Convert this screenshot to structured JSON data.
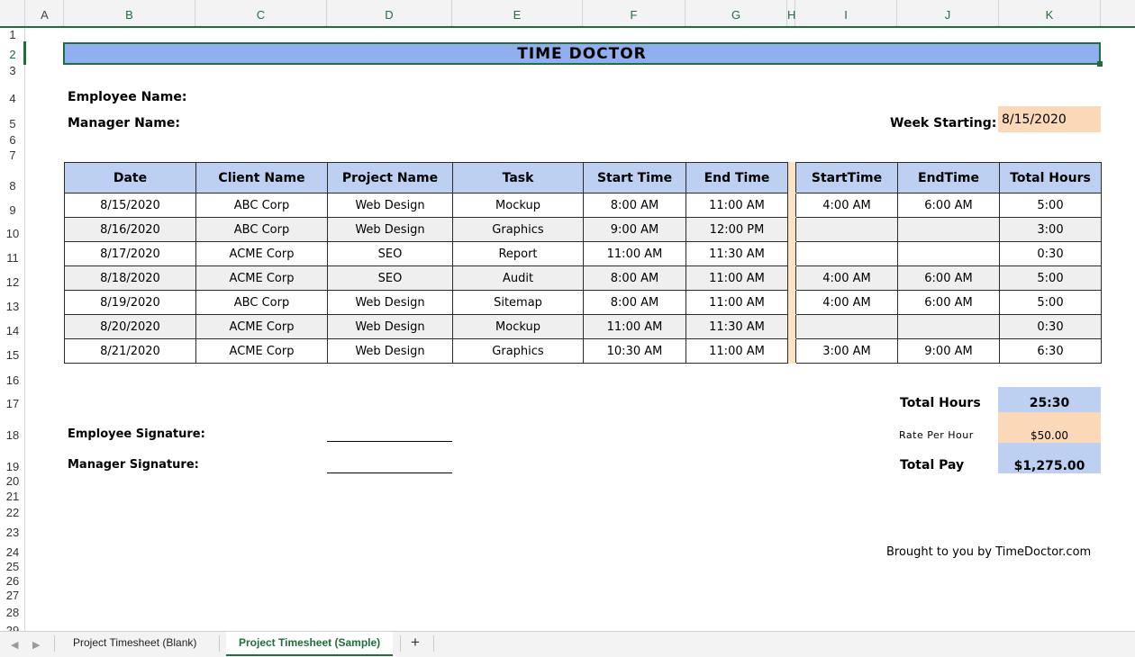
{
  "columns": [
    "A",
    "B",
    "C",
    "D",
    "E",
    "F",
    "G",
    "H",
    "I",
    "J",
    "K"
  ],
  "rows": [
    "1",
    "2",
    "3",
    "4",
    "5",
    "6",
    "7",
    "8",
    "9",
    "10",
    "11",
    "12",
    "13",
    "14",
    "15",
    "16",
    "17",
    "18",
    "19",
    "20",
    "21",
    "22",
    "23",
    "24",
    "25",
    "26",
    "27",
    "28",
    "29"
  ],
  "title": "TIME DOCTOR",
  "employee_label": "Employee Name:",
  "manager_label": "Manager Name:",
  "week_label": "Week Starting:",
  "week_value": "8/15/2020",
  "table": {
    "headers": [
      "Date",
      "Client Name",
      "Project Name",
      "Task",
      "Start Time",
      "End Time",
      "StartTime",
      "EndTime",
      "Total Hours"
    ],
    "rows": [
      [
        "8/15/2020",
        "ABC Corp",
        "Web Design",
        "Mockup",
        "8:00 AM",
        "11:00 AM",
        "4:00 AM",
        "6:00 AM",
        "5:00"
      ],
      [
        "8/16/2020",
        "ABC Corp",
        "Web Design",
        "Graphics",
        "9:00 AM",
        "12:00 PM",
        "",
        "",
        "3:00"
      ],
      [
        "8/17/2020",
        "ACME Corp",
        "SEO",
        "Report",
        "11:00 AM",
        "11:30 AM",
        "",
        "",
        "0:30"
      ],
      [
        "8/18/2020",
        "ACME Corp",
        "SEO",
        "Audit",
        "8:00 AM",
        "11:00 AM",
        "4:00 AM",
        "6:00 AM",
        "5:00"
      ],
      [
        "8/19/2020",
        "ABC Corp",
        "Web Design",
        "Sitemap",
        "8:00 AM",
        "11:00 AM",
        "4:00 AM",
        "6:00 AM",
        "5:00"
      ],
      [
        "8/20/2020",
        "ACME Corp",
        "Web Design",
        "Mockup",
        "11:00 AM",
        "11:30 AM",
        "",
        "",
        "0:30"
      ],
      [
        "8/21/2020",
        "ACME Corp",
        "Web Design",
        "Graphics",
        "10:30 AM",
        "11:00 AM",
        "3:00 AM",
        "9:00 AM",
        "6:30"
      ]
    ]
  },
  "summary": {
    "total_hours_label": "Total Hours",
    "total_hours_value": "25:30",
    "rate_label": "Rate Per Hour",
    "rate_value": "$50.00",
    "total_pay_label": "Total Pay",
    "total_pay_value": "$1,275.00"
  },
  "employee_signature_label": "Employee Signature:",
  "manager_signature_label": "Manager Signature:",
  "footer": "Brought to you by TimeDoctor.com",
  "sheet_tabs": [
    "Project Timesheet (Blank)",
    "Project Timesheet (Sample)"
  ],
  "add_sheet": "+",
  "nav_prev": "◀",
  "nav_next": "▶",
  "colors": {
    "title_bg": "#8faff0",
    "header_bg": "#bdd0f2",
    "accent_orange": "#fad8b8",
    "accent_green": "#1f6e3c"
  }
}
